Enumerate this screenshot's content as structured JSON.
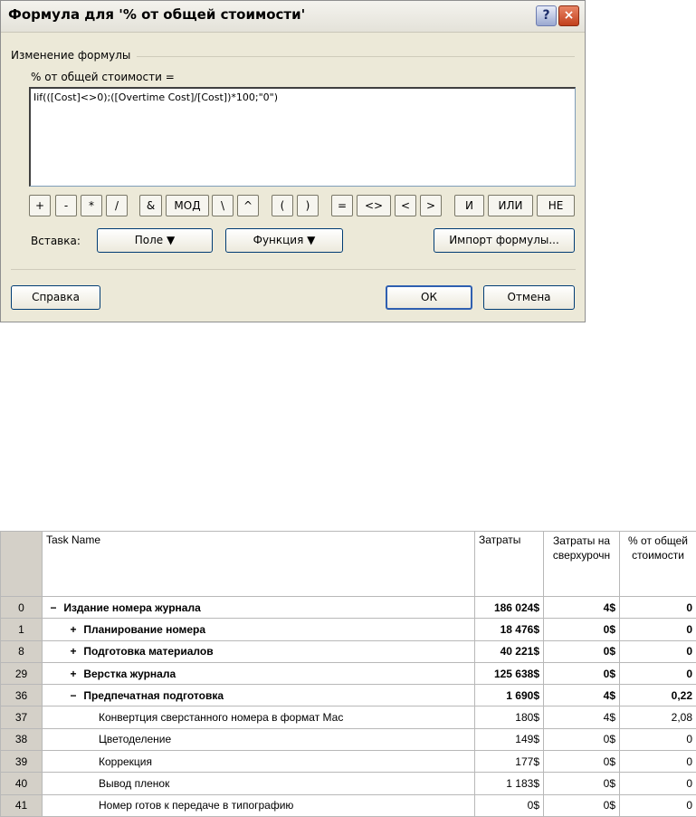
{
  "dialog": {
    "title": "Формула для '% от общей стоимости'",
    "help_btn": "?",
    "close_btn": "×",
    "group_label": "Изменение формулы",
    "formula_label": "% от общей стоимости =",
    "formula_value": "Iif(([Cost]<>0);([Overtime Cost]/[Cost])*100;\"0\")",
    "operators": [
      "+",
      "-",
      "*",
      "/",
      "&",
      "МОД",
      "\\",
      "^",
      "(",
      ")",
      "=",
      "<>",
      "<",
      ">",
      "И",
      "ИЛИ",
      "НЕ"
    ],
    "insert_label": "Вставка:",
    "field_btn": "Поле ▼",
    "function_btn": "Функция ▼",
    "import_btn": "Импорт формулы...",
    "help_button": "Справка",
    "ok_button": "ОК",
    "cancel_button": "Отмена"
  },
  "table": {
    "headers": {
      "task_name": "Task Name",
      "cost": "Затраты",
      "overtime": "Затраты на сверхурочн",
      "percent": "% от общей стоимости"
    },
    "rows": [
      {
        "id": "0",
        "tree": "−",
        "name": "Издание номера журнала",
        "cost": "186 024$",
        "overtime": "4$",
        "percent": "0",
        "bold": true,
        "level": 0
      },
      {
        "id": "1",
        "tree": "+",
        "name": "Планирование номера",
        "cost": "18 476$",
        "overtime": "0$",
        "percent": "0",
        "bold": true,
        "level": 1
      },
      {
        "id": "8",
        "tree": "+",
        "name": "Подготовка материалов",
        "cost": "40 221$",
        "overtime": "0$",
        "percent": "0",
        "bold": true,
        "level": 1
      },
      {
        "id": "29",
        "tree": "+",
        "name": "Верстка журнала",
        "cost": "125 638$",
        "overtime": "0$",
        "percent": "0",
        "bold": true,
        "level": 1
      },
      {
        "id": "36",
        "tree": "−",
        "name": "Предпечатная подготовка",
        "cost": "1 690$",
        "overtime": "4$",
        "percent": "0,22",
        "bold": true,
        "level": 1
      },
      {
        "id": "37",
        "tree": "",
        "name": "Конвертция сверстанного номера в формат Мас",
        "cost": "180$",
        "overtime": "4$",
        "percent": "2,08",
        "bold": false,
        "level": 2
      },
      {
        "id": "38",
        "tree": "",
        "name": "Цветоделение",
        "cost": "149$",
        "overtime": "0$",
        "percent": "0",
        "bold": false,
        "level": 2
      },
      {
        "id": "39",
        "tree": "",
        "name": "Коррекция",
        "cost": "177$",
        "overtime": "0$",
        "percent": "0",
        "bold": false,
        "level": 2
      },
      {
        "id": "40",
        "tree": "",
        "name": "Вывод пленок",
        "cost": "1 183$",
        "overtime": "0$",
        "percent": "0",
        "bold": false,
        "level": 2
      },
      {
        "id": "41",
        "tree": "",
        "name": "Номер готов к передаче в типографию",
        "cost": "0$",
        "overtime": "0$",
        "percent": "0",
        "bold": false,
        "level": 2
      }
    ]
  }
}
